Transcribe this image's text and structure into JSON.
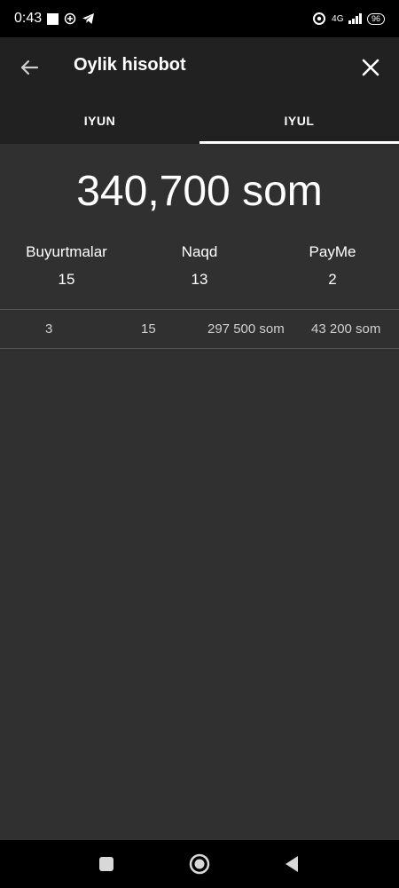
{
  "status_bar": {
    "time": "0:43",
    "network": "4G",
    "battery": "96"
  },
  "header": {
    "title": "Oylik hisobot"
  },
  "tabs": [
    {
      "label": "IYUN",
      "active": false
    },
    {
      "label": "IYUL",
      "active": true
    }
  ],
  "summary": {
    "total": "340,700 som",
    "stats": [
      {
        "label": "Buyurtmalar",
        "value": "15"
      },
      {
        "label": "Naqd",
        "value": "13"
      },
      {
        "label": "PayMe",
        "value": "2"
      }
    ]
  },
  "rows": [
    {
      "c1": "3",
      "c2": "15",
      "c3": "297 500 som",
      "c4": "43 200 som"
    }
  ],
  "colors": {
    "background": "#303030",
    "app_bar": "#212121",
    "system_bars": "#000000",
    "text": "#ffffff",
    "muted_text": "#d0d0d0"
  }
}
